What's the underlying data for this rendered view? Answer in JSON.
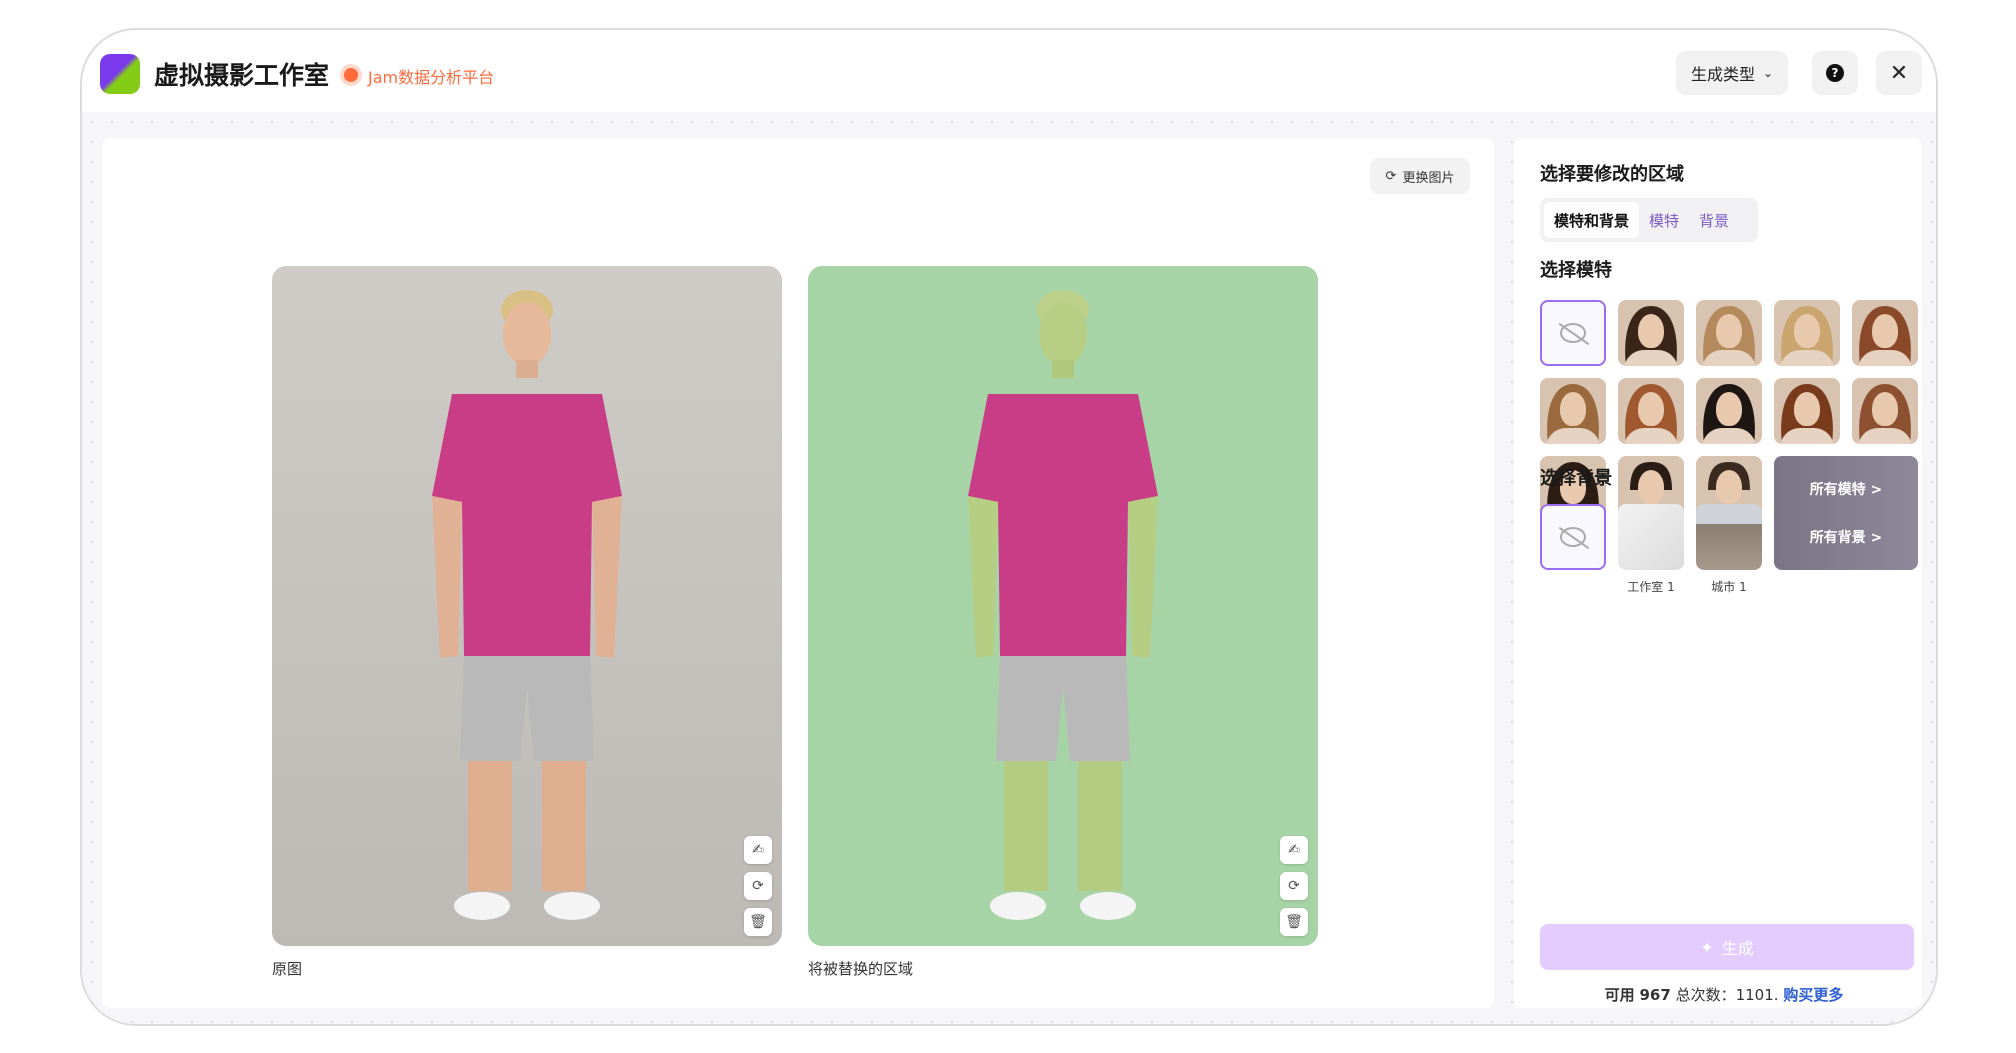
{
  "app": {
    "title": "虚拟摄影工作室",
    "platform_label": "Jam数据分析平台",
    "brand_colors": {
      "accent_purple": "#9b6df0",
      "status_orange": "#ff6b3d",
      "logo_green": "#84cc16"
    }
  },
  "header": {
    "generation_type_label": "生成类型",
    "help_icon": "question-circle-icon",
    "close_icon": "close-icon"
  },
  "canvas": {
    "swap_image_label": "更换图片",
    "original_caption": "原图",
    "replaced_caption": "将被替换的区域",
    "image_tools": [
      "brush-icon",
      "refresh-icon",
      "trash-icon"
    ]
  },
  "panel": {
    "region_title": "选择要修改的区域",
    "region_tabs": [
      {
        "label": "模特和背景",
        "active": true
      },
      {
        "label": "模特",
        "active": false
      },
      {
        "label": "背景",
        "active": false
      }
    ],
    "model_title": "选择模特",
    "all_models_label": "所有模特 >",
    "background_title": "选择背景",
    "backgrounds": [
      {
        "label": "工作室 1"
      },
      {
        "label": "城市 1"
      }
    ],
    "all_backgrounds_label": "所有背景 >",
    "generate_label": "生成",
    "quota_prefix": "可用",
    "quota_available": "967",
    "quota_total_label": "总次数：",
    "quota_total": "1101.",
    "buy_more_label": "购买更多"
  }
}
